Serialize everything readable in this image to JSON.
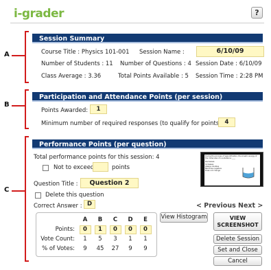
{
  "app": {
    "title": "i-grader",
    "help_label": "?"
  },
  "section_markers": {
    "a": "A",
    "b": "B",
    "c": "C"
  },
  "session": {
    "header": "Session Summary",
    "course_title_label": "Course Title : Physics 101-001",
    "session_name_label": "Session Name :",
    "session_name_value": "6/10/09",
    "students_label": "Number of Students : 11",
    "questions_label": "Number of Questions : 4",
    "session_date_label": "Session Date : 6/10/09",
    "class_average_label": "Class Average : 3.36",
    "total_points_label": "Total Points Available : 5",
    "session_time_label": "Session Time : 2:28 PM"
  },
  "participation": {
    "header": "Participation and Attendance Points (per session)",
    "points_awarded_label": "Points Awarded:",
    "points_awarded_value": "1",
    "min_responses_label": "Minimum number of required responses (to qualify for points) :",
    "min_responses_value": "4"
  },
  "performance": {
    "header": "Performance Points (per question)",
    "total_label": "Total performance points for this session:",
    "total_value": "4",
    "not_exceed_label": "Not to exceed",
    "not_exceed_value": "",
    "points_suffix": "points",
    "question_title_label": "Question Title :",
    "question_title_value": "Question 2",
    "delete_question_label": "Delete this question",
    "correct_answer_label": "Correct Answer :",
    "correct_answer_value": "D",
    "previous_label": "< Previous",
    "next_label": "Next >",
    "view_histogram_label": "View Histogram",
    "view_screenshot_label": "VIEW SCREENSHOT",
    "delete_session_label": "Delete Session",
    "set_close_label": "Set and Close",
    "cancel_label": "Cancel",
    "table": {
      "columns": [
        "A",
        "B",
        "C",
        "D",
        "E"
      ],
      "points_label": "Points:",
      "points": [
        "0",
        "1",
        "0",
        "0",
        "0"
      ],
      "vote_count_label": "Vote Count:",
      "vote_counts": [
        "1",
        "5",
        "3",
        "1",
        "1"
      ],
      "pct_votes_label": "% of Votes:",
      "pct_votes": [
        "9",
        "45",
        "27",
        "9",
        "9"
      ]
    },
    "thumbnail": {
      "text": "During the process of saponification, the kinetic energy of the molecules of a substance ____",
      "options": [
        "Decreases",
        "Increases",
        "Always doubles",
        "Becomes negative",
        "Does not change"
      ]
    }
  },
  "colors": {
    "header_bg": "#123a73",
    "bracket": "#d21b1b",
    "field_bg": "#fff8c4",
    "logo": "#7cb842"
  }
}
